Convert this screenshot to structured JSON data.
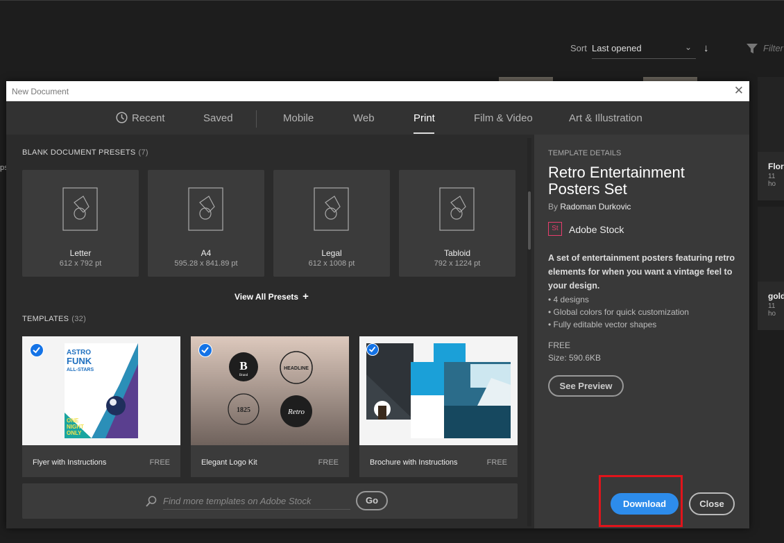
{
  "app": {
    "sort_label": "Sort",
    "sort_value": "Last opened",
    "filter_placeholder": "Filter",
    "side_cards": [
      {
        "title": "Flora",
        "sub": "11 ho"
      },
      {
        "title": "gold",
        "sub": "11 ho"
      }
    ],
    "left_edge_text": "ps"
  },
  "dialog": {
    "title": "New Document",
    "tabs": [
      "Recent",
      "Saved",
      "Mobile",
      "Web",
      "Print",
      "Film & Video",
      "Art & Illustration"
    ],
    "active_tab": "Print",
    "presets_heading": "BLANK DOCUMENT PRESETS",
    "presets_count": "(7)",
    "presets": [
      {
        "name": "Letter",
        "size": "612 x 792 pt"
      },
      {
        "name": "A4",
        "size": "595.28 x 841.89 pt"
      },
      {
        "name": "Legal",
        "size": "612 x 1008 pt"
      },
      {
        "name": "Tabloid",
        "size": "792 x 1224 pt"
      }
    ],
    "view_all": "View All Presets",
    "templates_heading": "TEMPLATES",
    "templates_count": "(32)",
    "templates": [
      {
        "name": "Flyer with Instructions",
        "price": "FREE"
      },
      {
        "name": "Elegant Logo Kit",
        "price": "FREE"
      },
      {
        "name": "Brochure with Instructions",
        "price": "FREE"
      }
    ],
    "flyer_text": {
      "l1": "ASTRO",
      "l2": "FUNK",
      "l3": "ALL-STARS",
      "l4": "ONE",
      "l5": "NIGHT",
      "l6": "ONLY"
    },
    "logo_text": {
      "b": "B",
      "brand": "Brand",
      "headline": "HEADLINE",
      "year": "1825",
      "retro": "Retro"
    },
    "search_placeholder": "Find more templates on Adobe Stock",
    "go_label": "Go",
    "details": {
      "label": "TEMPLATE DETAILS",
      "title": "Retro Entertainment Posters Set",
      "by_prefix": "By",
      "author": "Radoman Durkovic",
      "stock_icon": "St",
      "stock_name": "Adobe Stock",
      "description": "A set of entertainment posters featuring retro elements for when you want a vintage feel to your design.",
      "bullets": [
        "4 designs",
        "Global colors for quick customization",
        "Fully editable vector shapes"
      ],
      "price": "FREE",
      "size": "Size: 590.6KB",
      "preview_label": "See Preview",
      "download_label": "Download",
      "close_label": "Close"
    }
  },
  "colors": {
    "accent": "#2d8ceb",
    "highlight": "#e1141b",
    "check": "#1473e6",
    "stock": "#e83e6e"
  }
}
